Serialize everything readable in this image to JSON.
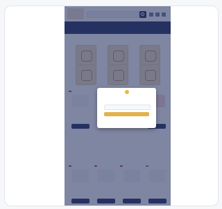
{
  "site": {
    "logo_text": "",
    "search_placeholder": ""
  },
  "nav": {
    "row1": [
      "",
      "",
      "",
      "",
      "",
      "",
      ""
    ],
    "row2": [
      "",
      "",
      "",
      ""
    ]
  },
  "products": [
    {
      "title": "",
      "price": "",
      "button": "",
      "badge": ""
    },
    {
      "title": "",
      "price": "",
      "button": "",
      "badge": ""
    },
    {
      "title": "",
      "price": "",
      "button": "",
      "badge": ""
    },
    {
      "title": "",
      "price": "",
      "button": "",
      "badge": ""
    },
    {
      "title": "",
      "price": "",
      "button": "",
      "badge": ""
    },
    {
      "title": "",
      "price": "",
      "button": "",
      "badge": ""
    }
  ],
  "modal": {
    "title": "",
    "subtitle": "",
    "email_placeholder": "",
    "primary_button": "",
    "link_left": "",
    "link_right": "",
    "footer_note": ""
  }
}
